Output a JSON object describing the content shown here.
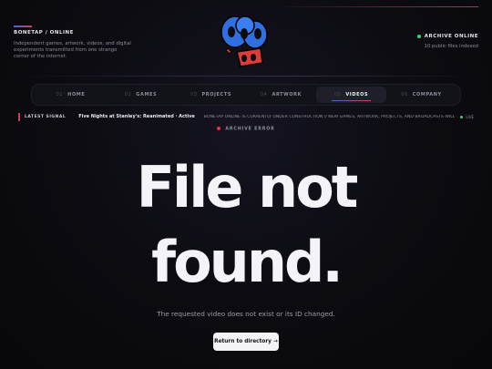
{
  "brand": {
    "name": "BONETAP / ONLINE",
    "tagline": "Independent games, artwork, videos, and digital experiments transmitted from one strange corner of the internet."
  },
  "logo": {
    "alt": "BoneTap logo"
  },
  "archive": {
    "status": "ARCHIVE ONLINE",
    "count": "10 public files indexed"
  },
  "nav": {
    "items": [
      {
        "num": "01",
        "label": "HOME"
      },
      {
        "num": "02",
        "label": "GAMES"
      },
      {
        "num": "03",
        "label": "PROJECTS"
      },
      {
        "num": "04",
        "label": "ARTWORK"
      },
      {
        "num": "05",
        "label": "VIDEOS"
      },
      {
        "num": "06",
        "label": "COMPANY"
      }
    ],
    "active": "VIDEOS"
  },
  "ticker": {
    "label": "LATEST SIGNAL",
    "game": "Five Nights at Stanley's: Reanimated · Active",
    "message": "BONETAP ONLINE IS CURRENTLY UNDER CONSTRUCTION // NEW GAMES, ARTWORK, PROJECTS, AND BROADCASTS WILL APPEAR HERE // WE...",
    "live": "LIVE"
  },
  "error": {
    "tag": "ARCHIVE ERROR",
    "line1": "File not",
    "line2": "found.",
    "message": "The requested video does not exist or its ID changed.",
    "button": "Return to directory →"
  },
  "colors": {
    "accent_red": "#d23a5a",
    "accent_blue": "#3b6fd4",
    "online_green": "#34d27a",
    "background": "#0b0b10"
  }
}
